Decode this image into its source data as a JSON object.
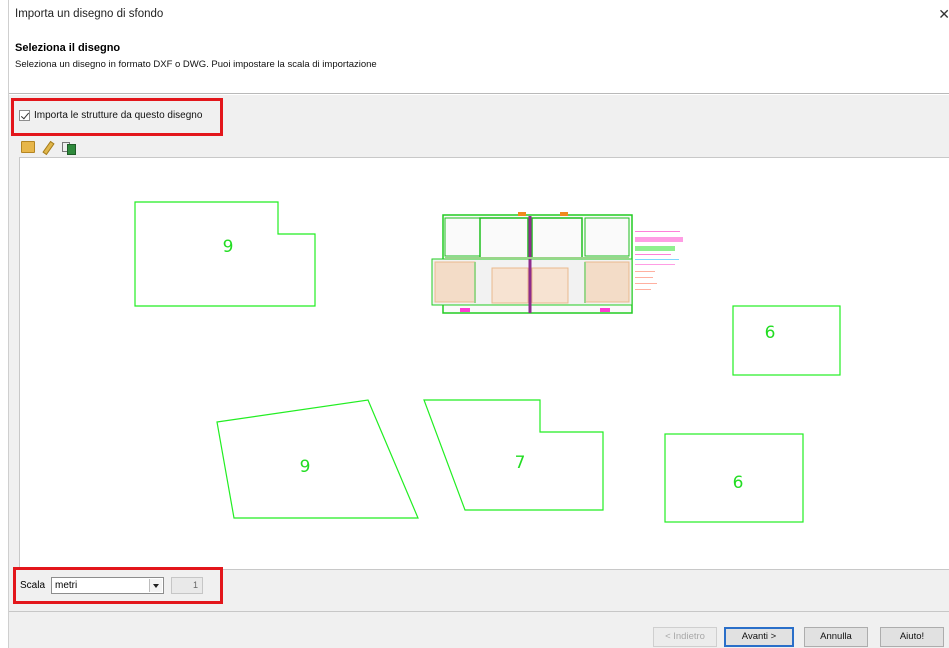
{
  "window": {
    "title": "Importa un disegno di sfondo",
    "close_glyph": "✕"
  },
  "header": {
    "title": "Seleziona il disegno",
    "subtitle": "Seleziona un disegno in formato DXF o DWG. Puoi impostare la scala di importazione"
  },
  "import_checkbox": {
    "label": "Importa le strutture da questo disegno",
    "checked": true
  },
  "toolbar": {
    "icons": [
      "open-folder-icon",
      "edit-pencil-icon",
      "layers-icon"
    ]
  },
  "drawing": {
    "shape_labels": [
      "9",
      "6",
      "9",
      "7",
      "6"
    ],
    "line_color": "#22ee22"
  },
  "scale": {
    "label": "Scala",
    "unit": "metri",
    "value": "1"
  },
  "footer": {
    "back": "< Indietro",
    "next": "Avanti >",
    "cancel": "Annulla",
    "help": "Aiuto!"
  },
  "colors": {
    "highlight": "#e3161b",
    "primary_border": "#2a6fc9"
  }
}
